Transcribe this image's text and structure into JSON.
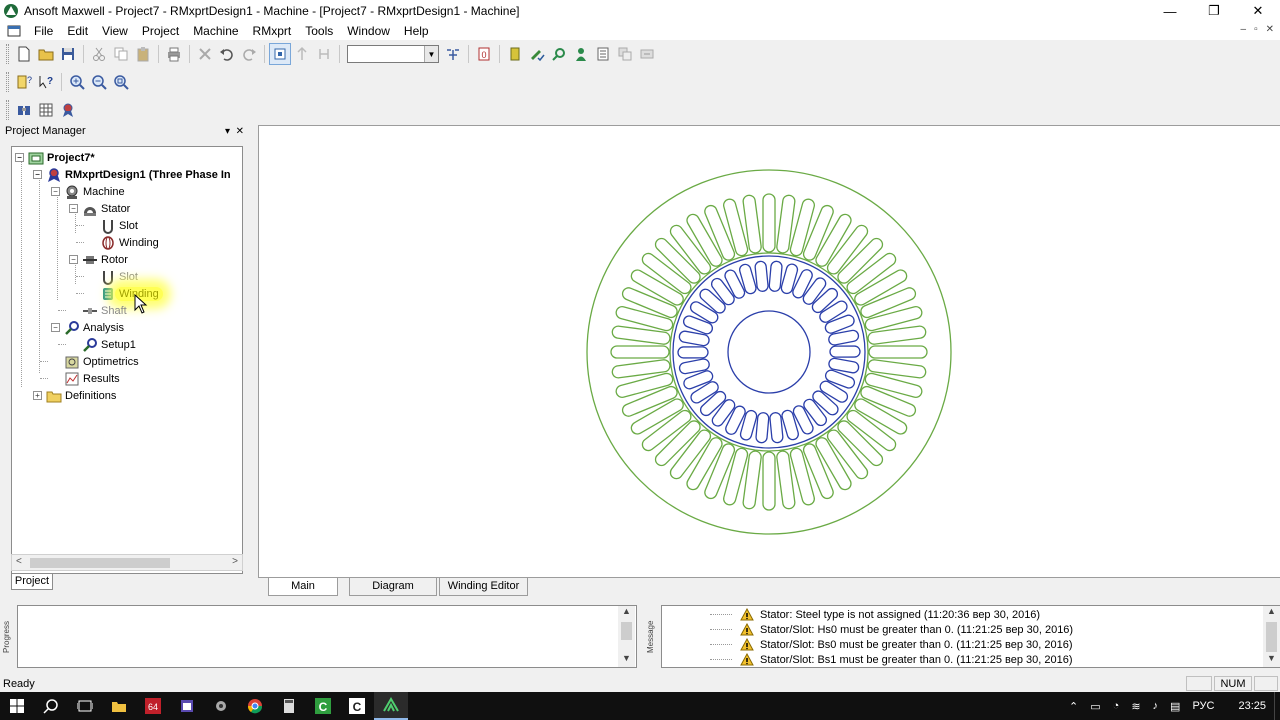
{
  "window": {
    "title": "Ansoft Maxwell - Project7 - RMxprtDesign1 - Machine - [Project7 - RMxprtDesign1 - Machine]"
  },
  "menu": [
    "File",
    "Edit",
    "View",
    "Project",
    "Machine",
    "RMxprt",
    "Tools",
    "Window",
    "Help"
  ],
  "project_manager": {
    "title": "Project Manager",
    "tree": {
      "project": "Project7*",
      "design": "RMxprtDesign1 (Three Phase In",
      "machine": "Machine",
      "stator": "Stator",
      "stator_slot": "Slot",
      "stator_winding": "Winding",
      "rotor": "Rotor",
      "rotor_slot": "Slot",
      "rotor_winding": "Winding",
      "shaft": "Shaft",
      "analysis": "Analysis",
      "setup": "Setup1",
      "optimetrics": "Optimetrics",
      "results": "Results",
      "definitions": "Definitions"
    },
    "tab": "Project"
  },
  "canvas_tabs": [
    "Main",
    "Diagram",
    "Winding Editor"
  ],
  "side_labels": {
    "progress": "Progress",
    "message": "Message"
  },
  "messages": [
    "Stator: Steel type is not assigned (11:20:36 вер 30, 2016)",
    "Stator/Slot: Hs0 must be greater than 0. (11:21:25 вер 30, 2016)",
    "Stator/Slot: Bs0 must be greater than 0. (11:21:25 вер 30, 2016)",
    "Stator/Slot: Bs1 must be greater than 0. (11:21:25 вер 30, 2016)"
  ],
  "status": {
    "text": "Ready",
    "num": "NUM"
  },
  "taskbar": {
    "lang": "РУС",
    "time": "23:25"
  },
  "colors": {
    "stator": "#6aaa45",
    "rotor": "#2b3faa",
    "highlight": "#ffff55"
  }
}
